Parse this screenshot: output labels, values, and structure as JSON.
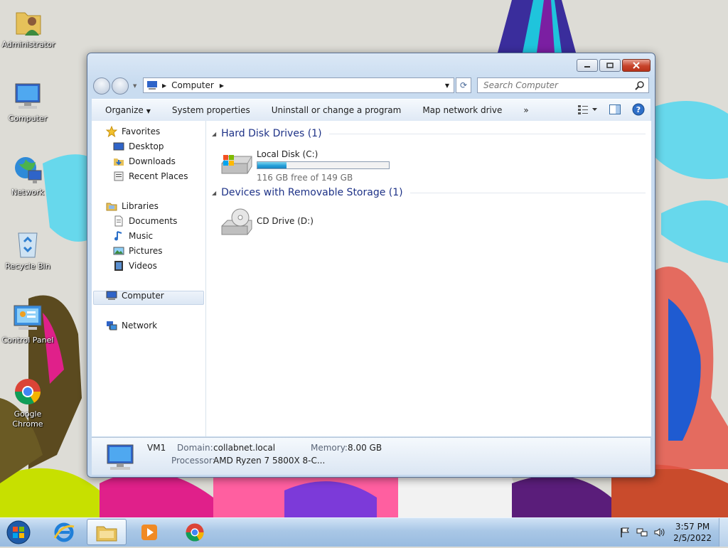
{
  "desktop": {
    "icons": [
      {
        "label": "Administrator"
      },
      {
        "label": "Computer"
      },
      {
        "label": "Network"
      },
      {
        "label": "Recycle Bin"
      },
      {
        "label": "Control Panel"
      },
      {
        "label": "Google Chrome"
      }
    ]
  },
  "window": {
    "address": {
      "crumb": "Computer"
    },
    "search": {
      "placeholder": "Search Computer"
    },
    "toolbar": {
      "organize": "Organize",
      "system_properties": "System properties",
      "uninstall": "Uninstall or change a program",
      "map_drive": "Map network drive",
      "more": "»"
    },
    "nav": {
      "favorites": "Favorites",
      "desktop": "Desktop",
      "downloads": "Downloads",
      "recent": "Recent Places",
      "libraries": "Libraries",
      "documents": "Documents",
      "music": "Music",
      "pictures": "Pictures",
      "videos": "Videos",
      "computer": "Computer",
      "network": "Network"
    },
    "groups": {
      "hdd": {
        "title": "Hard Disk Drives (1)"
      },
      "removable": {
        "title": "Devices with Removable Storage (1)"
      }
    },
    "drives": {
      "local": {
        "name": "Local Disk (C:)",
        "free_text": "116 GB free of 149 GB",
        "used_fraction": 0.22
      },
      "cd": {
        "name": "CD Drive (D:)"
      }
    },
    "details": {
      "name": "VM1",
      "domain_label": "Domain:",
      "domain": "collabnet.local",
      "memory_label": "Memory:",
      "memory": "8.00 GB",
      "processor_label": "Processor:",
      "processor": "AMD Ryzen 7 5800X 8-C..."
    }
  },
  "taskbar": {
    "clock_time": "3:57 PM",
    "clock_date": "2/5/2022"
  },
  "colors": {
    "accent_blue": "#1e3287",
    "progress_fill": "#26a0da",
    "taskbar": "#a9c7e6"
  }
}
